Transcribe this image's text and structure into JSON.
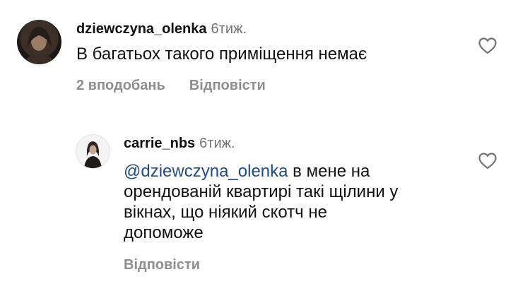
{
  "comments": [
    {
      "username": "dziewczyna_olenka",
      "time": "6тиж.",
      "text": "В багатьох такого приміщення немає",
      "likes": "2 вподобань",
      "reply": "Відповісти"
    },
    {
      "username": "carrie_nbs",
      "time": "6тиж.",
      "mention": "@dziewczyna_olenka",
      "text_line1": "в мене на",
      "text_line2": "орендованій квартирі такі щілини у",
      "text_line3": "вікнах, що ніякий скотч не",
      "text_line4": "допоможе",
      "reply": "Відповісти"
    }
  ]
}
